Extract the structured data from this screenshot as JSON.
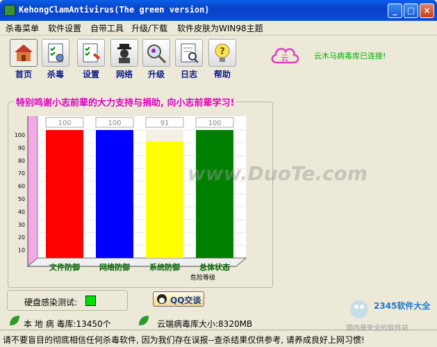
{
  "window": {
    "title": "KehongClamAntivirus(The green version)"
  },
  "menu": [
    "杀毒菜单",
    "软件设置",
    "自带工具",
    "升级/下载",
    "软件皮肤为WIN98主题"
  ],
  "toolbar": [
    {
      "label": "首页",
      "icon": "house-icon"
    },
    {
      "label": "杀毒",
      "icon": "scan-icon"
    },
    {
      "label": "设置",
      "icon": "settings-icon"
    },
    {
      "label": "网络",
      "icon": "network-icon"
    },
    {
      "label": "升级",
      "icon": "upgrade-icon"
    },
    {
      "label": "日志",
      "icon": "log-icon"
    },
    {
      "label": "帮助",
      "icon": "help-icon"
    }
  ],
  "cloud": {
    "icon_text": "云",
    "status": "云木马病毒库已连接!"
  },
  "group_title": "特别鸣谢小志前辈的大力支持与捐助, 向小志前辈学习!",
  "chart_data": {
    "type": "bar",
    "categories": [
      "文件防御",
      "网络防御",
      "系统防御",
      "总体状态"
    ],
    "values": [
      100,
      100,
      91,
      100
    ],
    "colors": [
      "#FF0000",
      "#0000FF",
      "#FFFF00",
      "#008000"
    ],
    "ylim": [
      0,
      100
    ],
    "yticks": [
      10,
      20,
      30,
      40,
      50,
      60,
      70,
      80,
      90,
      100
    ],
    "xlabel": "危险等级",
    "ylabel": "",
    "title": ""
  },
  "infection": {
    "label": "硬盘感染测试:",
    "color": "#00E000"
  },
  "qq_button": "QQ交谈",
  "stats": {
    "local": "本 地 病 毒库:13450个",
    "cloud": "云端病毒库大小:8320MB"
  },
  "status_bar": "请不要盲目的彻底相信任何杀毒软件, 因为我们存在误报--查杀结果仅供参考, 请养成良好上网习惯!",
  "watermarks": {
    "center": "www.DuoTe.com",
    "corner_brand": "2345软件大全",
    "corner_site": "国内最安全的软件站"
  }
}
